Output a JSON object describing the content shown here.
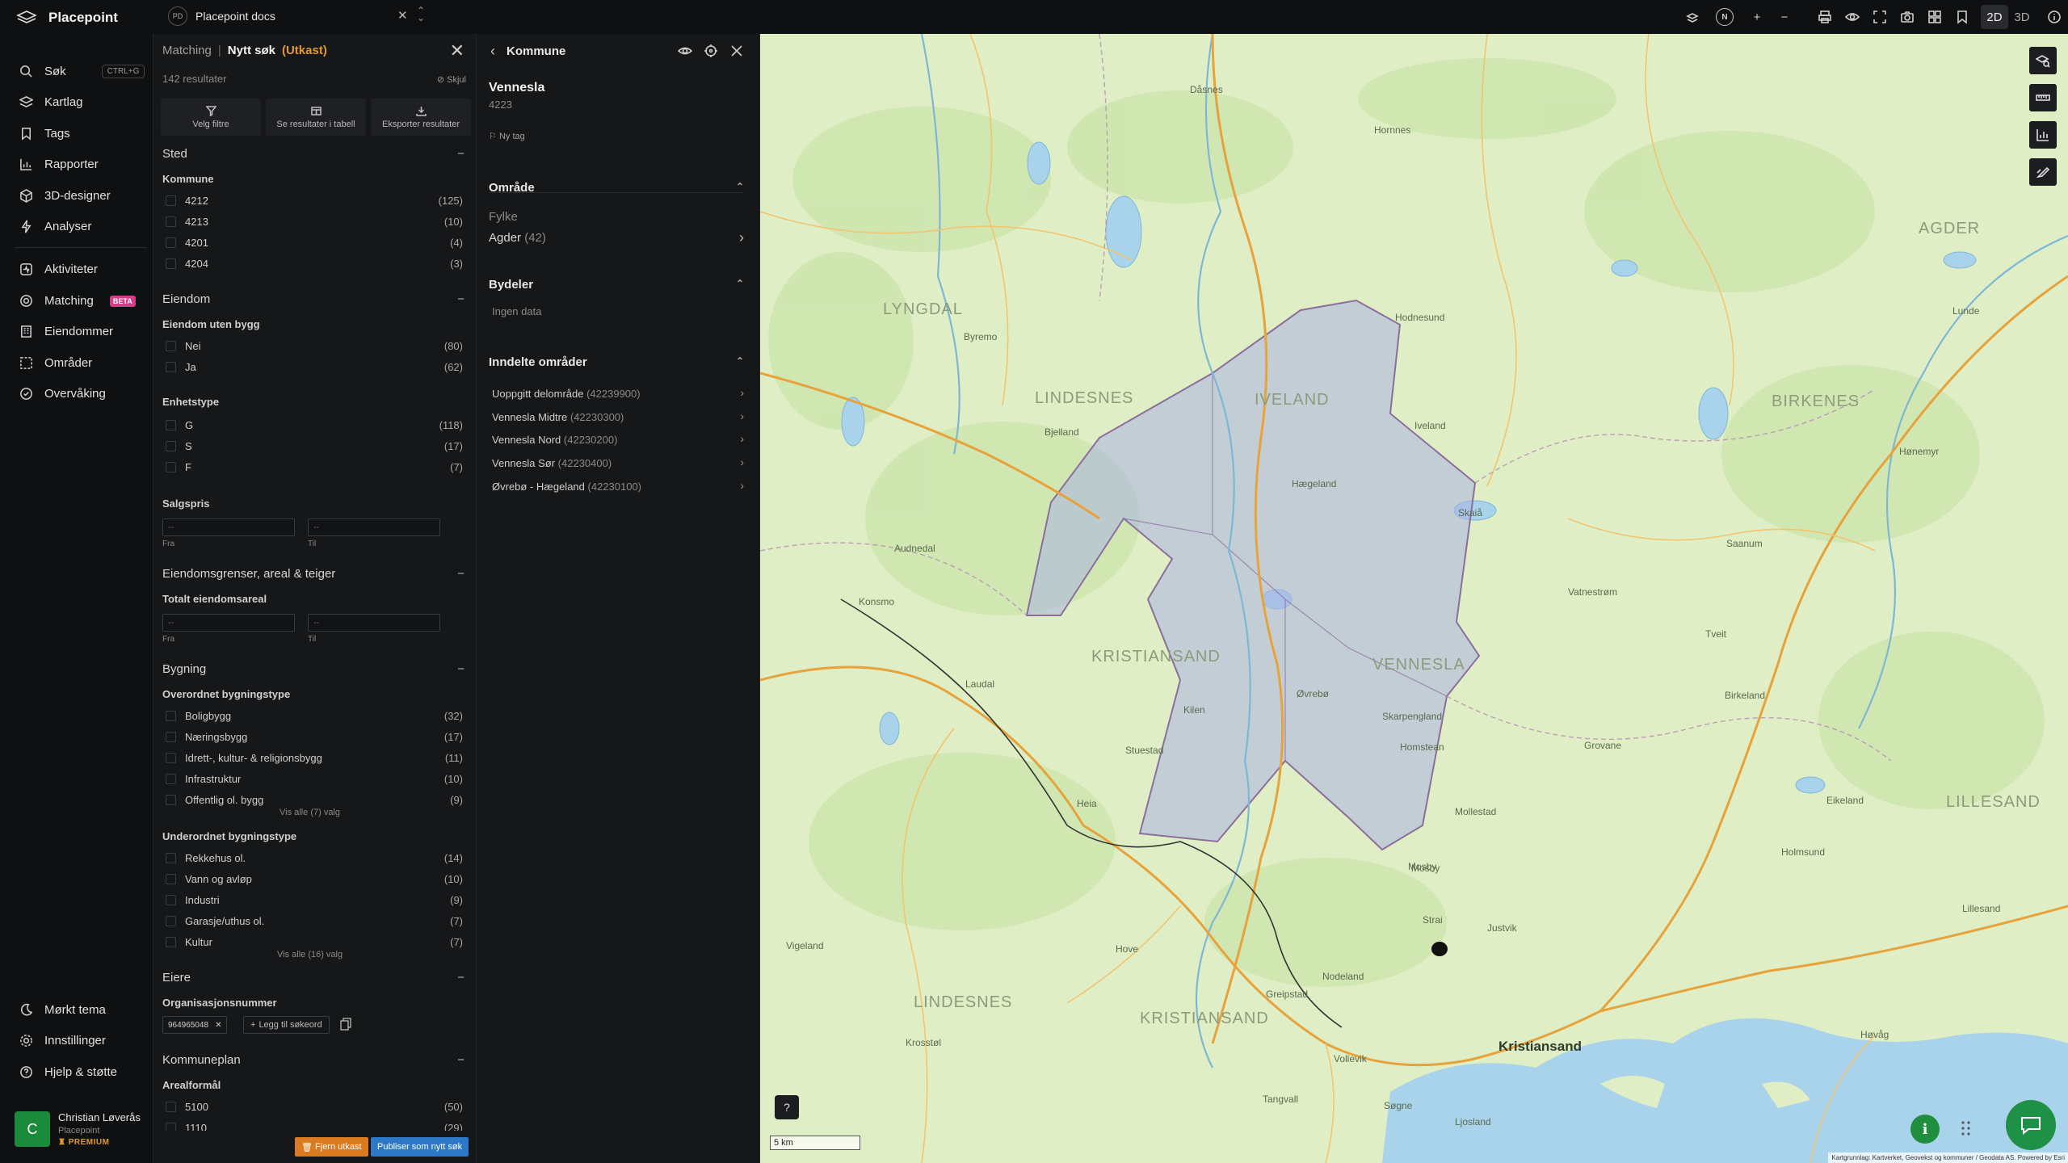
{
  "app": {
    "name": "Placepoint",
    "workspace_badge": "PD",
    "workspace_name": "Placepoint docs",
    "toolbar": {
      "compass": "N",
      "dim_2d": "2D",
      "dim_3d": "3D"
    }
  },
  "sidebar": {
    "search": {
      "label": "Søk",
      "shortcut": "CTRL+G"
    },
    "items_top": [
      "Kartlag",
      "Tags",
      "Rapporter",
      "3D-designer",
      "Analyser"
    ],
    "items_mid": [
      "Aktiviteter",
      "Matching",
      "Eiendommer",
      "Områder",
      "Overvåking"
    ],
    "beta": "BETA",
    "items_bottom": [
      "Mørkt tema",
      "Innstillinger",
      "Hjelp & støtte"
    ],
    "user": {
      "initial": "C",
      "name": "Christian Løverås",
      "org": "Placepoint",
      "plan": "PREMIUM"
    }
  },
  "filter_panel": {
    "crumb": "Matching",
    "sep": "|",
    "title": "Nytt søk",
    "status": "(Utkast)",
    "results": "142 resultater",
    "hide": "Skjul",
    "actions": [
      "Velg filtre",
      "Se resultater i tabell",
      "Eksporter resultater"
    ],
    "sections": {
      "sted": {
        "title": "Sted",
        "kommune_label": "Kommune",
        "kommune": [
          {
            "label": "4212",
            "count": "(125)"
          },
          {
            "label": "4213",
            "count": "(10)"
          },
          {
            "label": "4201",
            "count": "(4)"
          },
          {
            "label": "4204",
            "count": "(3)"
          }
        ]
      },
      "eiendom": {
        "title": "Eiendom",
        "uten_bygg_label": "Eiendom uten bygg",
        "uten_bygg": [
          {
            "label": "Nei",
            "count": "(80)"
          },
          {
            "label": "Ja",
            "count": "(62)"
          }
        ],
        "enhetstype_label": "Enhetstype",
        "enhetstype": [
          {
            "label": "G",
            "count": "(118)"
          },
          {
            "label": "S",
            "count": "(17)"
          },
          {
            "label": "F",
            "count": "(7)"
          }
        ],
        "salgspris_label": "Salgspris",
        "from": "Fra",
        "to": "Til",
        "placeholder": "--"
      },
      "grenser": {
        "title": "Eiendomsgrenser, areal & teiger",
        "areal_label": "Totalt eiendomsareal",
        "from": "Fra",
        "to": "Til",
        "placeholder": "--"
      },
      "bygning": {
        "title": "Bygning",
        "overordnet_label": "Overordnet bygningstype",
        "overordnet": [
          {
            "label": "Boligbygg",
            "count": "(32)"
          },
          {
            "label": "Næringsbygg",
            "count": "(17)"
          },
          {
            "label": "Idrett-, kultur- & religionsbygg",
            "count": "(11)"
          },
          {
            "label": "Infrastruktur",
            "count": "(10)"
          },
          {
            "label": "Offentlig ol. bygg",
            "count": "(9)"
          }
        ],
        "overordnet_more": "Vis alle (7) valg",
        "underordnet_label": "Underordnet bygningstype",
        "underordnet": [
          {
            "label": "Rekkehus ol.",
            "count": "(14)"
          },
          {
            "label": "Vann og avløp",
            "count": "(10)"
          },
          {
            "label": "Industri",
            "count": "(9)"
          },
          {
            "label": "Garasje/uthus ol.",
            "count": "(7)"
          },
          {
            "label": "Kultur",
            "count": "(7)"
          }
        ],
        "underordnet_more": "Vis alle (16) valg"
      },
      "eiere": {
        "title": "Eiere",
        "org_label": "Organisasjonsnummer",
        "chip": "964965048",
        "add_keyword": "Legg til søkeord"
      },
      "kommuneplan": {
        "title": "Kommuneplan",
        "areal_label": "Arealformål",
        "areal": [
          {
            "label": "5100",
            "count": "(50)"
          },
          {
            "label": "1110",
            "count": "(29)"
          }
        ]
      }
    },
    "remove_draft": "Fjern utkast",
    "publish": "Publiser som nytt søk"
  },
  "detail_panel": {
    "title": "Kommune",
    "name": "Vennesla",
    "code": "4223",
    "new_tag": "Ny tag",
    "omrade": {
      "title": "Område",
      "fylke_label": "Fylke",
      "fylke_value": "Agder",
      "fylke_code": "(42)"
    },
    "bydeler": {
      "title": "Bydeler",
      "empty": "Ingen data"
    },
    "inndelte": {
      "title": "Inndelte områder",
      "items": [
        {
          "name": "Uoppgitt delområde",
          "code": "(42239900)"
        },
        {
          "name": "Vennesla Midtre",
          "code": "(42230300)"
        },
        {
          "name": "Vennesla Nord",
          "code": "(42230200)"
        },
        {
          "name": "Vennesla Sør",
          "code": "(42230400)"
        },
        {
          "name": "Øvrebø - Hægeland",
          "code": "(42230100)"
        }
      ]
    }
  },
  "map": {
    "regions": [
      "AGDER",
      "LYNGDAL",
      "LINDESNES",
      "IVELAND",
      "BIRKENES",
      "KRISTIANSAND",
      "VENNESLA",
      "LILLESAND",
      "LINDESNES",
      "KRISTIANSAND"
    ],
    "towns": [
      "Kristiansand"
    ],
    "places": [
      "Dåsnes",
      "Hornnes",
      "Hodnesund",
      "Byremo",
      "Bjelland",
      "Kilen",
      "Konsmo",
      "Øvrebø",
      "Hægeland",
      "Skarpengland",
      "Homstean",
      "Mosby",
      "Strai",
      "Nodeland",
      "Justvik",
      "Birkeland",
      "Lillesand",
      "Søgne",
      "Lunde",
      "Høvåg",
      "Vigeland",
      "Audnedal",
      "Stuestad",
      "Saanum",
      "Eikeland",
      "Grovane",
      "Krosstøl",
      "Mollestad",
      "Holmsund",
      "Hove",
      "Tveit",
      "Iveland",
      "Skaiå",
      "Vatnestrøm",
      "Heia",
      "Laudal",
      "Hønemyr",
      "Greipstad",
      "Tangvall",
      "Vollevik",
      "Ljosland",
      "Mosby"
    ],
    "scale": "5 km",
    "attribution": "Kartgrunnlag: Kartverket, Geovekst og kommuner / Geodata AS. Powered by Esri",
    "colors": {
      "land": "#dfeec4",
      "forest": "#cfe6b0",
      "water": "#a9d3ea",
      "road": "#e7a33b",
      "highlight": "#a9b3e3",
      "border": "#8b6e9c"
    }
  }
}
